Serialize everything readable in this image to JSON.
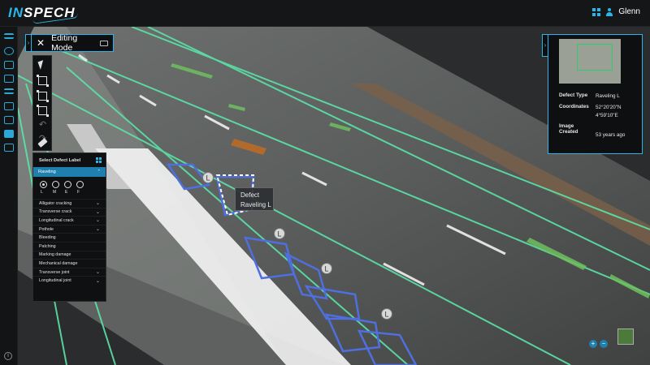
{
  "app": {
    "logo_part1": "IN",
    "logo_part2": "SPECH"
  },
  "header": {
    "user_name": "Glenn"
  },
  "editing": {
    "title": "Editing Mode",
    "close": "✕",
    "tab_arrow": "›"
  },
  "label_panel": {
    "title": "Select Defect Label",
    "selected": "Raveling",
    "severity_levels": [
      "L",
      "M",
      "E",
      "F"
    ],
    "selected_severity": "L",
    "items": [
      {
        "label": "Alligator cracking",
        "expandable": true
      },
      {
        "label": "Transverse crack",
        "expandable": true
      },
      {
        "label": "Longitudinal crack",
        "expandable": true
      },
      {
        "label": "Pothole",
        "expandable": true
      },
      {
        "label": "Bleeding",
        "expandable": false
      },
      {
        "label": "Patching",
        "expandable": false
      },
      {
        "label": "Marking damage",
        "expandable": false
      },
      {
        "label": "Mechanical damage",
        "expandable": false
      },
      {
        "label": "Transverse joint",
        "expandable": true
      },
      {
        "label": "Longitudinal joint",
        "expandable": true
      }
    ]
  },
  "tooltip": {
    "line1": "Defect",
    "line2": "Raveling L"
  },
  "marker_label": "L",
  "info": {
    "tab_arrow": "›",
    "defect_type_label": "Defect Type",
    "defect_type_value": "Raveling L",
    "coordinates_label": "Coordinates",
    "coordinates_lat": "52°20'20\"N",
    "coordinates_lon": "4°59'10\"E",
    "image_created_label_1": "Image",
    "image_created_label_2": "Created",
    "image_created_value": "53 years ago"
  },
  "controls": {
    "zoom_in": "+",
    "zoom_out": "−"
  },
  "rail": {
    "info": "i"
  },
  "colors": {
    "accent": "#29b6e8",
    "lane_line": "#5be3a8",
    "defect_box": "#4f6fe0"
  }
}
